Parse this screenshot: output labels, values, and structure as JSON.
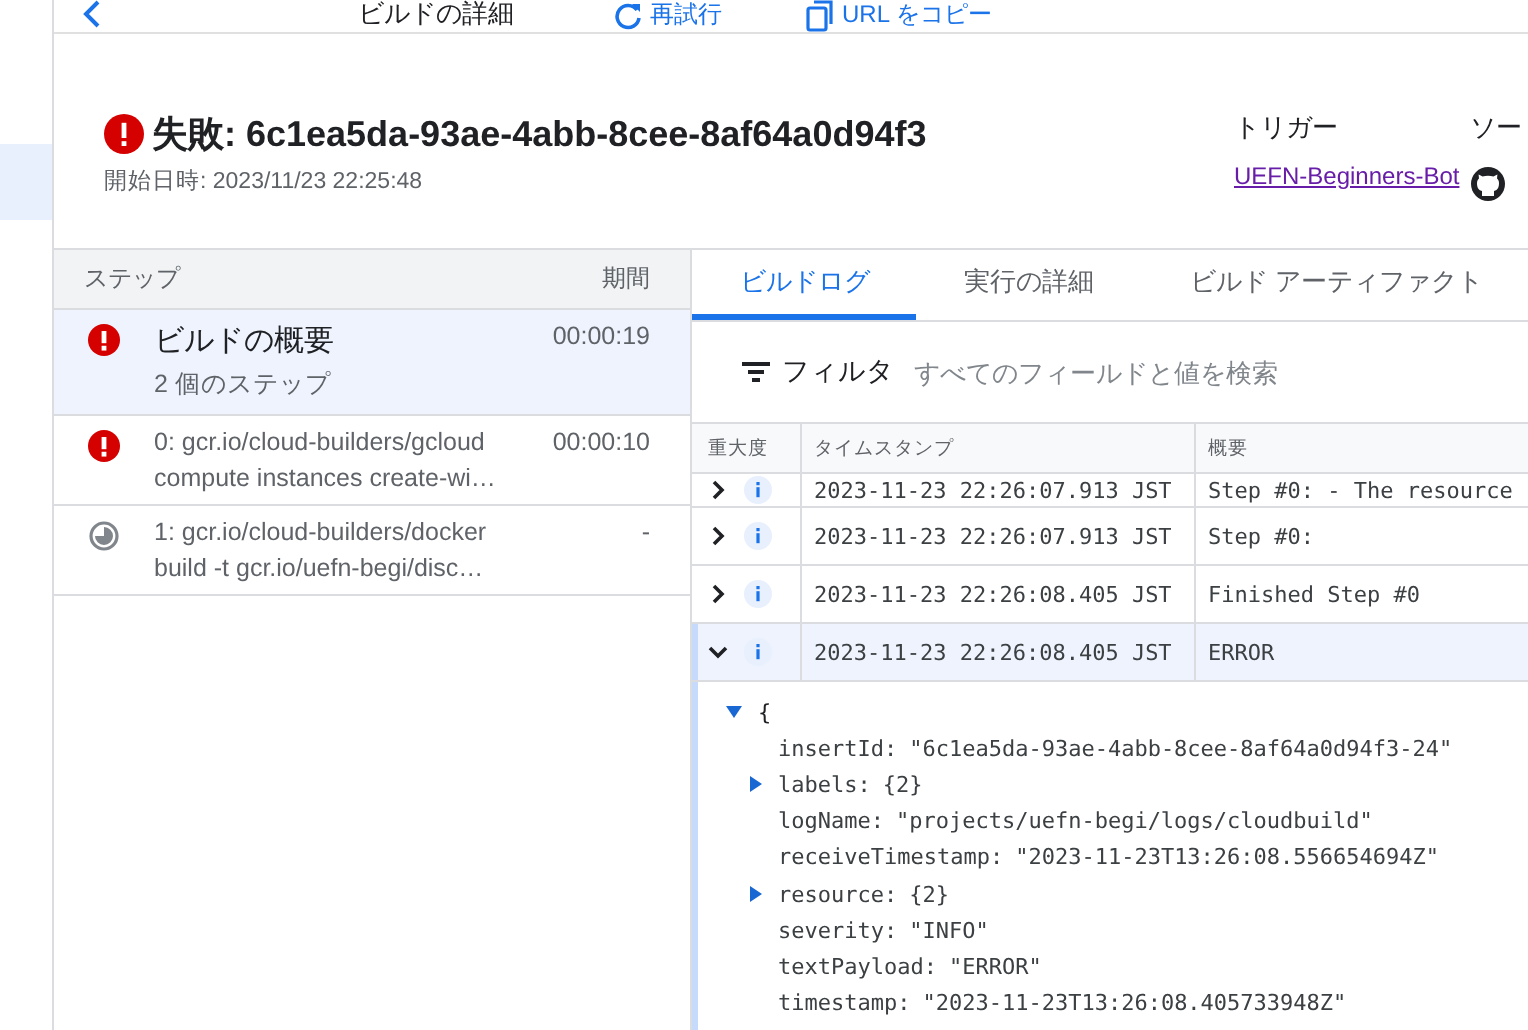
{
  "top_bar": {
    "title": "ビルドの詳細",
    "actions": [
      {
        "label": "再試行",
        "kind": "retry"
      },
      {
        "label": "URL をコピー",
        "kind": "copy"
      }
    ]
  },
  "build": {
    "failed": true,
    "title": "失敗: 6c1ea5da-93ae-4abb-8cee-8af64a0d94f3",
    "started": "開始日時: 2023/11/23 22:25:48"
  },
  "meta": [
    {
      "label": "トリガー",
      "value": "UEFN-Beginners-Bot",
      "kind": "link"
    },
    {
      "label": "ソー",
      "kind": "github"
    }
  ],
  "steps": {
    "columns": [
      "ステップ",
      "期間"
    ],
    "items": [
      {
        "kind": "summary_error",
        "selected": true,
        "title": "ビルドの概要",
        "subtitle": "2 個のステップ",
        "duration": "00:00:19"
      },
      {
        "kind": "step_error",
        "selected": false,
        "title": "0: gcr.io/cloud-builders/gcloud",
        "subtitle": "compute instances create-wi…",
        "duration": "00:00:10"
      },
      {
        "kind": "step_pending",
        "selected": false,
        "title": "1: gcr.io/cloud-builders/docker",
        "subtitle": "build -t gcr.io/uefn-begi/disc…",
        "duration": "-"
      }
    ]
  },
  "tabs": [
    {
      "label": "ビルドログ",
      "selected": true
    },
    {
      "label": "実行の詳細",
      "selected": false
    },
    {
      "label": "ビルド アーティファクト",
      "selected": false
    }
  ],
  "filter": {
    "label": "フィルタ",
    "placeholder": "すべてのフィールドと値を検索"
  },
  "log": {
    "columns": [
      "重大度",
      "タイムスタンプ",
      "概要"
    ],
    "rows": [
      {
        "kind": "info",
        "expanded": false,
        "timestamp": "2023-11-23 22:26:07.913 JST",
        "summary": "Step #0:  - The resource"
      },
      {
        "kind": "info",
        "expanded": false,
        "timestamp": "2023-11-23 22:26:07.913 JST",
        "summary": "Step #0:"
      },
      {
        "kind": "info",
        "expanded": false,
        "timestamp": "2023-11-23 22:26:08.405 JST",
        "summary": "Finished Step #0"
      },
      {
        "kind": "info",
        "expanded": true,
        "timestamp": "2023-11-23 22:26:08.405 JST",
        "summary": "ERROR"
      }
    ],
    "detail": {
      "open": "{",
      "fields": [
        {
          "key": "insertId:",
          "value": "\"6c1ea5da-93ae-4abb-8cee-8af64a0d94f3-24\"",
          "expandable": false
        },
        {
          "key": "labels:",
          "value": "{2}",
          "expandable": true
        },
        {
          "key": "logName:",
          "value": "\"projects/uefn-begi/logs/cloudbuild\"",
          "expandable": false
        },
        {
          "key": "receiveTimestamp:",
          "value": "\"2023-11-23T13:26:08.556654694Z\"",
          "expandable": false
        },
        {
          "key": "resource:",
          "value": "{2}",
          "expandable": true
        },
        {
          "key": "severity:",
          "value": "\"INFO\"",
          "expandable": false
        },
        {
          "key": "textPayload:",
          "value": "\"ERROR\"",
          "expandable": false
        },
        {
          "key": "timestamp:",
          "value": "\"2023-11-23T13:26:08.405733948Z\"",
          "expandable": false
        }
      ]
    }
  }
}
